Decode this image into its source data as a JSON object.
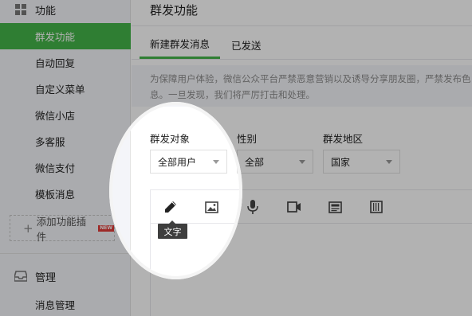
{
  "sidebar": {
    "function_section": {
      "label": "功能",
      "icon": "grid-icon"
    },
    "items": [
      {
        "label": "群发功能",
        "active": true
      },
      {
        "label": "自动回复"
      },
      {
        "label": "自定义菜单"
      },
      {
        "label": "微信小店"
      },
      {
        "label": "多客服"
      },
      {
        "label": "微信支付"
      },
      {
        "label": "模板消息"
      }
    ],
    "add_plugin": {
      "label": "添加功能插件",
      "badge": "NEW"
    },
    "manage_section": {
      "label": "管理",
      "icon": "inbox-icon"
    },
    "manage_items": [
      {
        "label": "消息管理"
      }
    ]
  },
  "main": {
    "title": "群发功能",
    "tabs": [
      {
        "label": "新建群发消息",
        "active": true
      },
      {
        "label": "已发送"
      }
    ],
    "notice": {
      "line1": "为保障用户体验，微信公众平台严禁恶意营销以及诱导分享朋友圈，严禁发布色",
      "line2": "息。一旦发现，我们将严厉打击和处理。"
    },
    "filters": [
      {
        "label": "群发对象",
        "value": "全部用户"
      },
      {
        "label": "性别",
        "value": "全部"
      },
      {
        "label": "群发地区",
        "value": "国家"
      }
    ],
    "toolbar": {
      "tools": [
        {
          "name": "text",
          "icon": "pencil-icon",
          "active": true
        },
        {
          "name": "image",
          "icon": "image-icon"
        },
        {
          "name": "voice",
          "icon": "microphone-icon"
        },
        {
          "name": "video",
          "icon": "video-icon"
        },
        {
          "name": "article",
          "icon": "article-icon"
        },
        {
          "name": "card",
          "icon": "card-icon"
        }
      ],
      "tooltip": "文字"
    }
  },
  "colors": {
    "accent": "#44b549",
    "sidebar_bg": "#f4f5f9",
    "badge": "#e13c38",
    "overlay": "rgba(0,0,0,0.3)"
  }
}
